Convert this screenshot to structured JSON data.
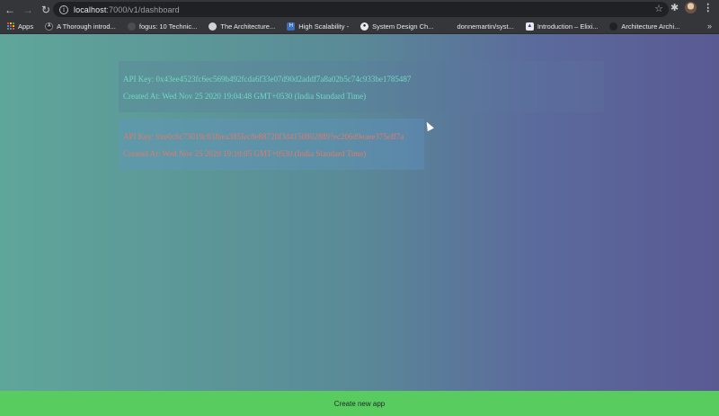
{
  "browser": {
    "url_host": "localhost",
    "url_path": ":7000/v1/dashboard",
    "bookmarks": [
      {
        "label": "Apps",
        "icon": "apps-grid-icon"
      },
      {
        "label": "A Thorough introd...",
        "icon": "bracket-icon"
      },
      {
        "label": "fogus: 10 Technic...",
        "icon": "globe-icon"
      },
      {
        "label": "The Architecture...",
        "icon": "globe-icon"
      },
      {
        "label": "High Scalability -",
        "icon": "hs-icon"
      },
      {
        "label": "System Design Ch...",
        "icon": "github-icon"
      },
      {
        "label": "donnemartin/syst...",
        "icon": "page-icon"
      },
      {
        "label": "Introduction – Elixi...",
        "icon": "elixir-icon"
      },
      {
        "label": "Architecture Archi...",
        "icon": "dot-icon"
      }
    ]
  },
  "apps": [
    {
      "api_key_line": "API Key: 0x43ee4523fc6ec569b492fcda6f33e07d90d2addf7a8a02b5c74c933be1785487",
      "created_line": "Created At: Wed Nov 25 2020 19:04:48 GMT+0530 (India Standard Time)"
    },
    {
      "api_key_line": "API Key: 0xe0c6c73019c83fbea385fec8e88720f3d4150802889?ec206d9eaee375eff7a",
      "created_line": "Created At: Wed Nov 25 2020 19:10:05 GMT+0530 (India Standard Time)"
    }
  ],
  "footer": {
    "create_label": "Create new app"
  }
}
